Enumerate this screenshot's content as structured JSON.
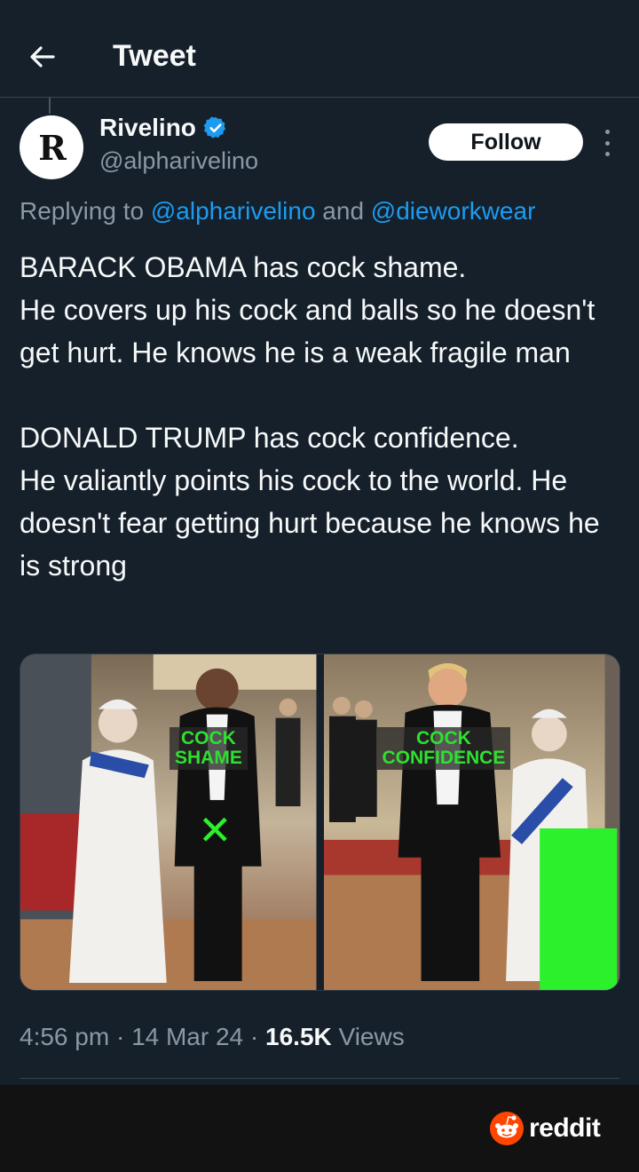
{
  "header": {
    "title": "Tweet",
    "back_icon": "arrow-left-icon"
  },
  "author": {
    "avatar_letter": "R",
    "name": "Rivelino",
    "handle": "@alpharivelino",
    "verified": true,
    "verified_color": "#1d9bf0"
  },
  "actions": {
    "follow_label": "Follow",
    "more_icon": "more-vertical-icon"
  },
  "reply": {
    "prefix": "Replying to ",
    "mention1": "@alpharivelino",
    "joiner": " and ",
    "mention2": "@dieworkwear"
  },
  "tweet": {
    "paragraph1": [
      "BARACK OBAMA has cock shame.",
      "He covers up his cock and balls so he doesn't get hurt. He knows he is a weak fragile man"
    ],
    "paragraph2": [
      "DONALD TRUMP has cock confidence.",
      "He valiantly points his cock to the world. He doesn't fear getting hurt because he knows he is strong"
    ]
  },
  "media": {
    "left_label_line1": "COCK",
    "left_label_line2": "SHAME",
    "left_mark": "✕",
    "right_label_line1": "COCK",
    "right_label_line2": "CONFIDENCE",
    "label_color": "#30e030"
  },
  "meta": {
    "time": "4:56 pm",
    "sep1": " · ",
    "date": "14 Mar 24",
    "sep2": " · ",
    "views_count": "16.5K",
    "views_label": " Views"
  },
  "footer": {
    "brand": "reddit",
    "brand_color": "#ff4500"
  },
  "colors": {
    "background": "#15202b",
    "secondary_text": "#8b98a5",
    "link": "#1d9bf0"
  }
}
